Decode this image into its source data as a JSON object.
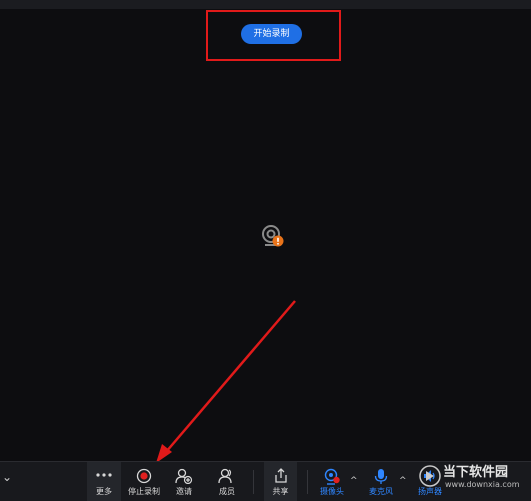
{
  "header": {
    "start_record_label": "开始录制"
  },
  "toolbar": {
    "collapse_glyph": "⌄",
    "more_label": "更多",
    "stop_record_label": "停止录制",
    "invite_label": "邀请",
    "members_label": "成员",
    "share_label": "共享",
    "camera_label": "摄像头",
    "mic_label": "麦克风",
    "speaker_label": "扬声器",
    "caret_glyph": "^"
  },
  "watermark": {
    "title": "当下软件园",
    "url": "www.downxia.com"
  },
  "colors": {
    "accent": "#1f6fe5",
    "annotation": "#e11a1a",
    "record": "#e02020",
    "warning": "#e8731a"
  }
}
